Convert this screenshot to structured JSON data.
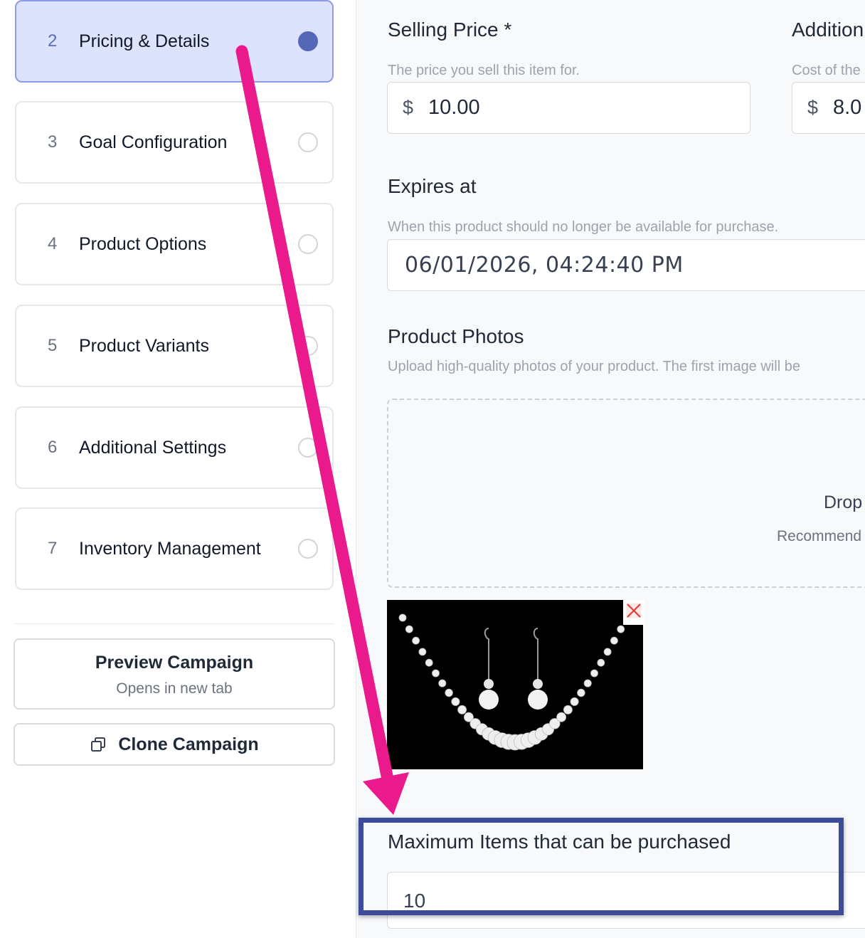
{
  "sidebar": {
    "steps": [
      {
        "number": "2",
        "label": "Pricing & Details",
        "active": true
      },
      {
        "number": "3",
        "label": "Goal Configuration",
        "active": false
      },
      {
        "number": "4",
        "label": "Product Options",
        "active": false
      },
      {
        "number": "5",
        "label": "Product Variants",
        "active": false
      },
      {
        "number": "6",
        "label": "Additional Settings",
        "active": false
      },
      {
        "number": "7",
        "label": "Inventory Management",
        "active": false
      }
    ],
    "preview_button": {
      "title": "Preview Campaign",
      "subtitle": "Opens in new tab"
    },
    "clone_button": {
      "title": "Clone Campaign",
      "icon": "clone-icon"
    }
  },
  "form": {
    "selling_price": {
      "label": "Selling Price *",
      "help": "The price you sell this item for.",
      "currency": "$",
      "value": "10.00"
    },
    "additional_cost": {
      "label": "Addition",
      "help": "Cost of the",
      "currency": "$",
      "value": "8.0"
    },
    "expires_at": {
      "label": "Expires at",
      "help": "When this product should no longer be available for purchase.",
      "value": "06/01/2026, 04:24:40 PM"
    },
    "product_photos": {
      "label": "Product Photos",
      "help": "Upload high-quality photos of your product. The first image will be",
      "dropzone_text": "Drop",
      "dropzone_sub": "Recommend"
    },
    "max_items": {
      "label": "Maximum Items that can be purchased",
      "value": "10"
    }
  },
  "colors": {
    "active_step_bg": "#dde3fd",
    "active_step_dot": "#5567b7",
    "annotation_arrow": "#ea1a8c",
    "highlight_box": "#3c4b9a"
  }
}
